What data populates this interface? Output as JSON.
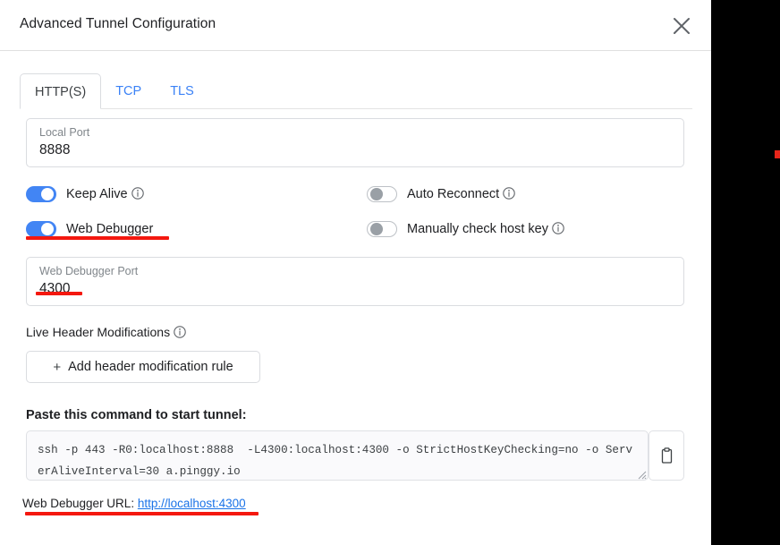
{
  "dialog": {
    "title": "Advanced Tunnel Configuration",
    "close_icon": "close-icon"
  },
  "tabs": [
    {
      "label": "HTTP(S)",
      "active": true
    },
    {
      "label": "TCP",
      "active": false
    },
    {
      "label": "TLS",
      "active": false
    }
  ],
  "fields": {
    "local_port": {
      "label": "Local Port",
      "value": "8888"
    },
    "web_debugger_port": {
      "label": "Web Debugger Port",
      "value": "4300"
    }
  },
  "toggles": [
    {
      "label": "Keep Alive",
      "state": "on",
      "has_info": true
    },
    {
      "label": "Auto Reconnect",
      "state": "off",
      "has_info": true
    },
    {
      "label": "Web Debugger",
      "state": "on",
      "has_info": false
    },
    {
      "label": "Manually check host key",
      "state": "off",
      "has_info": true
    }
  ],
  "header_mods": {
    "section_label": "Live Header Modifications",
    "add_rule_label": "Add header modification rule",
    "plus": "+"
  },
  "command": {
    "heading": "Paste this command to start tunnel:",
    "text": "ssh -p 443 -R0:localhost:8888  -L4300:localhost:4300 -o StrictHostKeyChecking=no -o ServerAliveInterval=30 a.pinggy.io",
    "copy_icon": "clipboard-icon"
  },
  "web_debugger_url": {
    "prefix": "Web Debugger URL:",
    "link_text": "http://localhost:4300"
  },
  "colors": {
    "accent_blue": "#4285f4",
    "link_blue": "#1a73e8",
    "annotation_red": "#f4180f",
    "text_primary": "#202124",
    "text_muted": "#80868b",
    "border": "#dadce0"
  }
}
